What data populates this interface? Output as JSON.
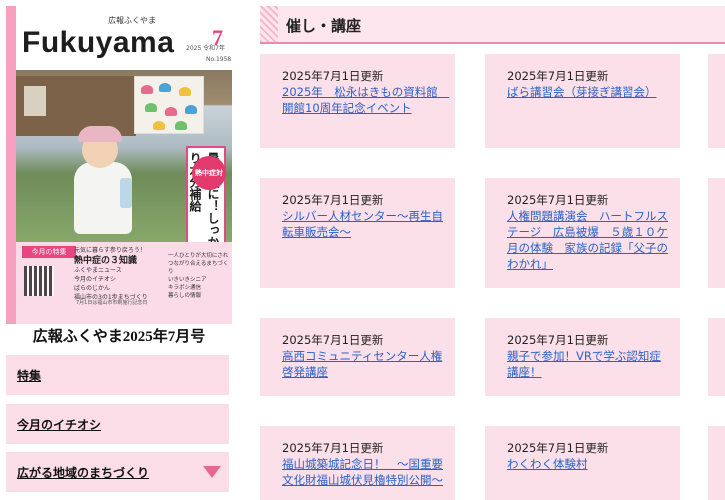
{
  "cover": {
    "logo": "Fukuyama",
    "kicker": "広報ふくやま",
    "year": "2025 令和7年",
    "month": "7",
    "issue_no": "No.1958",
    "headline_circle": "熱中症対策",
    "headline": "暑い夏に！しっかり水分補給",
    "toc_label": "今月の特集",
    "toc_lines": [
      "元気に暮らす参り戻ろう！"
    ],
    "toc_feature": "熱中症の３知識",
    "toc_items": [
      "ふくやまニュース",
      "今月のイチオシ",
      "ばらのじかん",
      "福山市の3の1歩まちづくり"
    ],
    "toc_side_items": [
      "一人ひとりが大切にされつながり合えるまちづくり",
      "いきいきシニア",
      "キラボシ通信",
      "暮らしの情報"
    ],
    "toc_footer": "7月1日は福山市市制施行記念日",
    "caption": "広報ふくやま2025年7月号"
  },
  "nav": {
    "items": [
      {
        "label": "特集"
      },
      {
        "label": "今月のイチオシ"
      },
      {
        "label": "広がる地域のまちづくり"
      }
    ]
  },
  "section": {
    "title": "催し・講座"
  },
  "cards": [
    {
      "date": "2025年7月1日更新",
      "link": "2025年　松永はきもの資料館　開館10周年記念イベント"
    },
    {
      "date": "2025年7月1日更新",
      "link": "ばら講習会（芽接ぎ講習会）"
    },
    {
      "date": "2025年7月1日更新",
      "link": "シルバー人材センター～再生自転車販売会～"
    },
    {
      "date": "2025年7月1日更新",
      "link": "人権問題講演会　ハートフルステージ　広島被爆　５歳１０ケ月の体験　家族の記録「父子のわかれ」"
    },
    {
      "date": "2025年7月1日更新",
      "link": "高西コミュニティセンター人権啓発講座"
    },
    {
      "date": "2025年7月1日更新",
      "link": "親子で参加！VRで学ぶ認知症講座！"
    },
    {
      "date": "2025年7月1日更新",
      "link": "福山城築城記念日！　～国重要文化財福山城伏見櫓特別公開～"
    },
    {
      "date": "2025年7月1日更新",
      "link": "わくわく体験村"
    }
  ],
  "colors": {
    "accent_pink": "#e8467f",
    "card_bg": "#fbdfe9",
    "link_blue": "#2a62c9"
  }
}
